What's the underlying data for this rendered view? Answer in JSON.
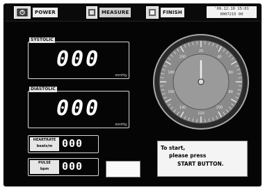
{
  "toolbar": {
    "power_label": "POWER",
    "measure_label": "MEASURE",
    "finish_label": "FINISH",
    "date_line1": "'09.12.10 15:01",
    "date_line2": "0007215 00"
  },
  "systolic": {
    "label": "SYSTOLIC",
    "value": "000",
    "unit": "mmHg"
  },
  "diastolic": {
    "label": "DIASTOLIC",
    "value": "000",
    "unit": "mmHg"
  },
  "heartrate": {
    "label_line1": "HEARTRATE",
    "label_line2": "beats/m",
    "value": "000"
  },
  "pulse": {
    "label_line1": "PULSE",
    "label_line2": "bpm",
    "value": "000"
  },
  "message": {
    "line1": "To start,",
    "line2": "please press",
    "line3": "START BUTTON."
  },
  "gauge": {
    "tick_labels": [
      "20",
      "40",
      "60",
      "80",
      "100",
      "120",
      "140",
      "160",
      "180",
      "200"
    ]
  },
  "colors": {
    "panel_bg": "#050505",
    "frame": "#d8d8d8"
  }
}
